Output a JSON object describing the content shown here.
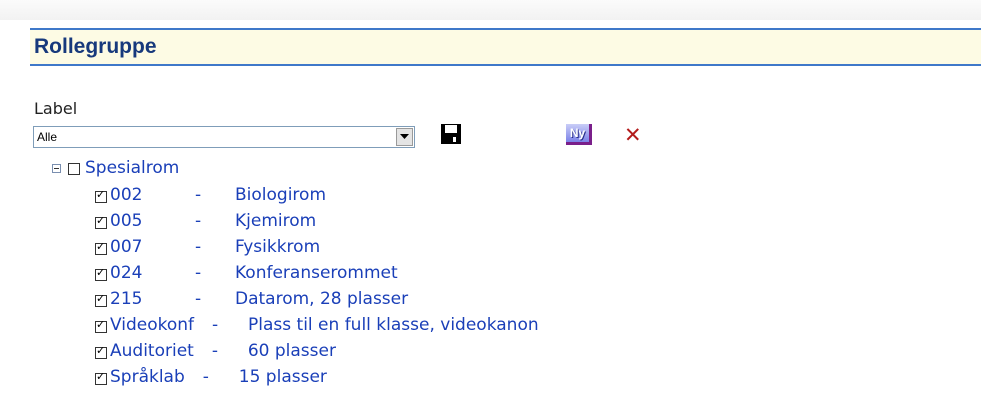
{
  "header": {
    "title": "Rollegruppe"
  },
  "form": {
    "label": "Label",
    "select_value": "Alle",
    "new_button_label": "Ny"
  },
  "tree": {
    "root": {
      "label": "Spesialrom",
      "checked": false,
      "expanded": true
    },
    "children": [
      {
        "code": "002",
        "separator": "-",
        "description": "Biologirom",
        "checked": true
      },
      {
        "code": "005",
        "separator": "-",
        "description": "Kjemirom",
        "checked": true
      },
      {
        "code": "007",
        "separator": "-",
        "description": "Fysikkrom",
        "checked": true
      },
      {
        "code": "024",
        "separator": "-",
        "description": "Konferanserommet",
        "checked": true
      },
      {
        "code": "215",
        "separator": "-",
        "description": "Datarom, 28 plasser",
        "checked": true
      },
      {
        "code": "Videokonf",
        "separator": "-",
        "description": "Plass til en full klasse, videokanon",
        "checked": true
      },
      {
        "code": "Auditoriet",
        "separator": "-",
        "description": "60 plasser",
        "checked": true
      },
      {
        "code": "Språklab",
        "separator": "-",
        "description": "15 plasser",
        "checked": true
      }
    ]
  },
  "colors": {
    "header_border": "#3f78c9",
    "header_bg": "#fdfbe4",
    "title": "#17397c",
    "tree_text": "#1a3fb8",
    "delete": "#b31b1b"
  },
  "icons": {
    "save": "floppy-disk-icon",
    "new": "new-item-icon",
    "delete": "delete-x-icon",
    "expander": "tree-collapse-icon",
    "dropdown": "chevron-down-icon"
  }
}
